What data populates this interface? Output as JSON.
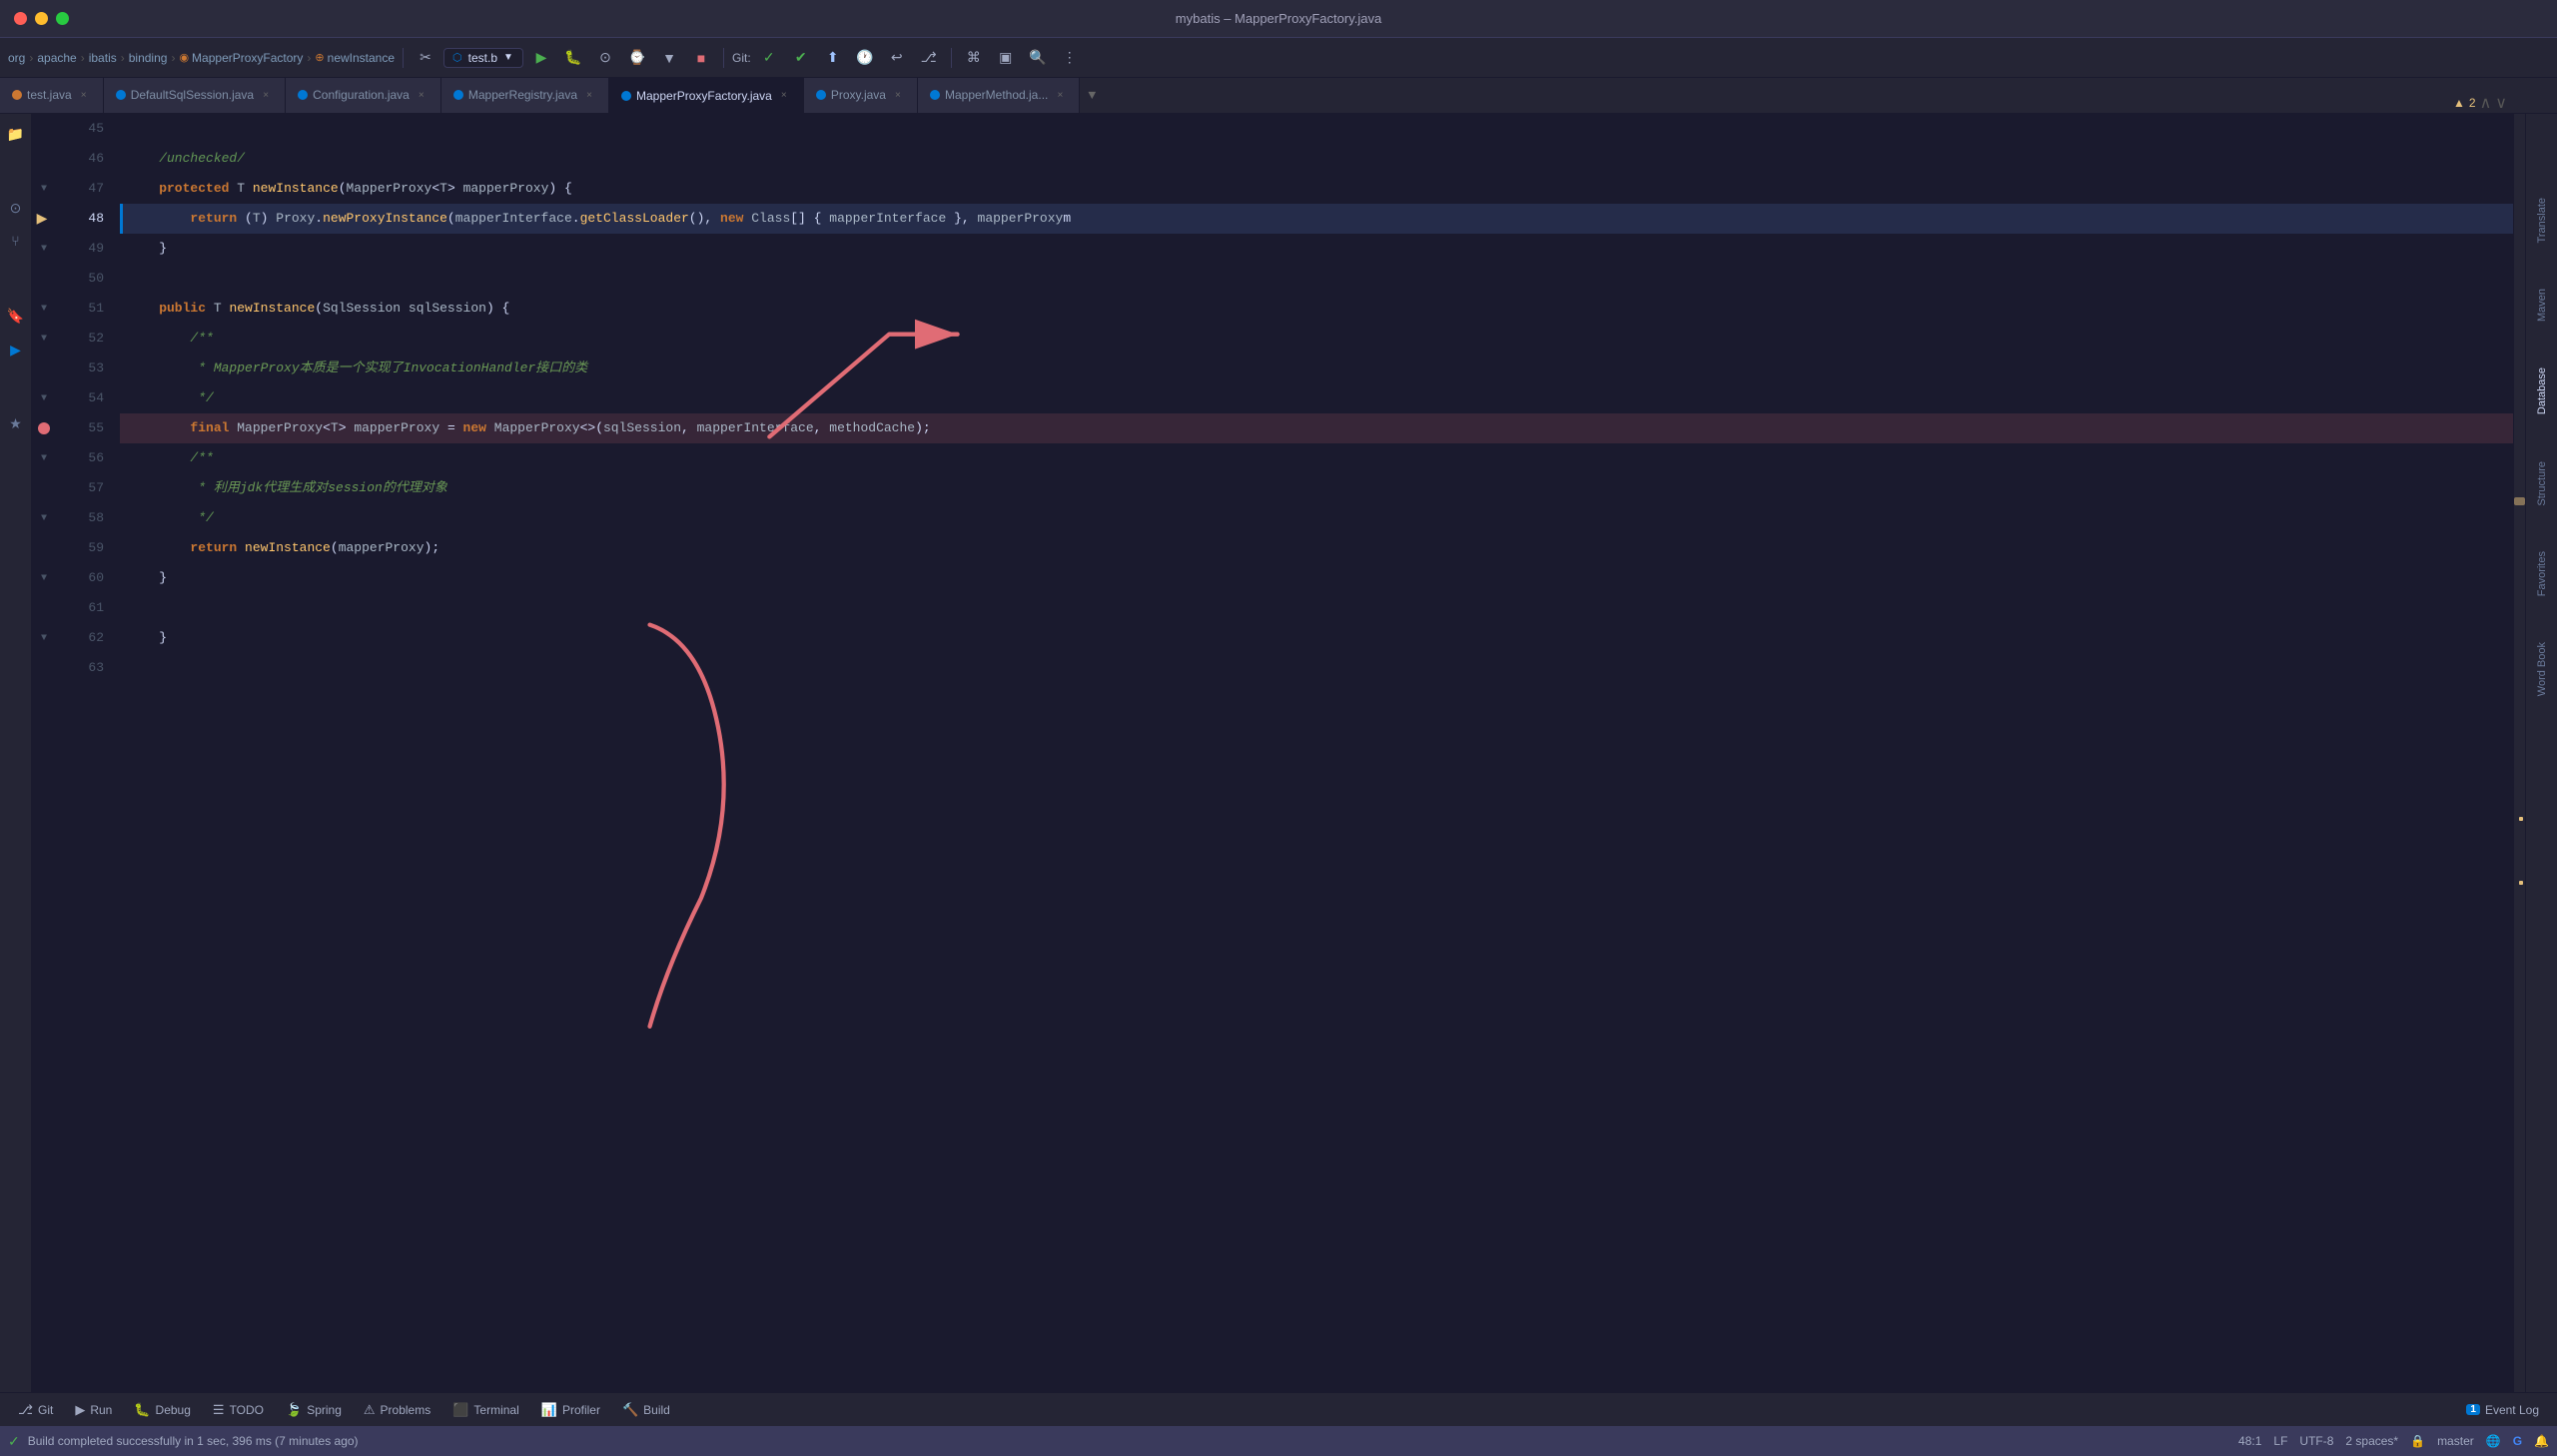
{
  "window": {
    "title": "mybatis – MapperProxyFactory.java"
  },
  "titlebar": {
    "title": "mybatis – MapperProxyFactory.java"
  },
  "toolbar": {
    "breadcrumb": [
      "org",
      "apache",
      "ibatis",
      "binding",
      "MapperProxyFactory",
      "newInstance"
    ],
    "run_config": "test.b",
    "git_label": "Git:"
  },
  "tabs": [
    {
      "label": "test.java",
      "color": "java",
      "active": false,
      "closeable": true
    },
    {
      "label": "DefaultSqlSession.java",
      "color": "java-blue",
      "active": false,
      "closeable": true
    },
    {
      "label": "Configuration.java",
      "color": "java-blue",
      "active": false,
      "closeable": true
    },
    {
      "label": "MapperRegistry.java",
      "color": "java-blue",
      "active": false,
      "closeable": true
    },
    {
      "label": "MapperProxyFactory.java",
      "color": "java-blue",
      "active": true,
      "closeable": true
    },
    {
      "label": "Proxy.java",
      "color": "java-blue",
      "active": false,
      "closeable": true
    },
    {
      "label": "MapperMethod.ja...",
      "color": "java-blue",
      "active": false,
      "closeable": true
    }
  ],
  "warning": {
    "count": "2",
    "symbol": "▲"
  },
  "code": {
    "lines": [
      {
        "num": 45,
        "content": "",
        "type": "empty"
      },
      {
        "num": 46,
        "content": "    /unchecked/",
        "type": "comment"
      },
      {
        "num": 47,
        "content": "    protected T newInstance(MapperProxy<T> mapperProxy) {",
        "type": "code"
      },
      {
        "num": 48,
        "content": "        return (T) Proxy.newProxyInstance(mapperInterface.getClassLoader(), new Class[] { mapperInterface }, mapperProxy",
        "type": "code",
        "active": true
      },
      {
        "num": 49,
        "content": "    }",
        "type": "code"
      },
      {
        "num": 50,
        "content": "",
        "type": "empty"
      },
      {
        "num": 51,
        "content": "    public T newInstance(SqlSession sqlSession) {",
        "type": "code"
      },
      {
        "num": 52,
        "content": "        /**",
        "type": "comment"
      },
      {
        "num": 53,
        "content": "         * MapperProxy本质是一个实现了InvocationHandler接口的类",
        "type": "comment-chinese"
      },
      {
        "num": 54,
        "content": "         */",
        "type": "comment"
      },
      {
        "num": 55,
        "content": "        final MapperProxy<T> mapperProxy = new MapperProxy<>(sqlSession, mapperInterface, methodCache);",
        "type": "code",
        "breakpoint": true
      },
      {
        "num": 56,
        "content": "        /**",
        "type": "comment"
      },
      {
        "num": 57,
        "content": "         * 利用jdk代理生成对session的代理对象",
        "type": "comment-chinese"
      },
      {
        "num": 58,
        "content": "         */",
        "type": "comment"
      },
      {
        "num": 59,
        "content": "        return newInstance(mapperProxy);",
        "type": "code"
      },
      {
        "num": 60,
        "content": "    }",
        "type": "code"
      },
      {
        "num": 61,
        "content": "",
        "type": "empty"
      },
      {
        "num": 62,
        "content": "}",
        "type": "code"
      },
      {
        "num": 63,
        "content": "",
        "type": "empty"
      }
    ]
  },
  "sidebar_right": {
    "labels": [
      "Translate",
      "Maven",
      "Database",
      "Structure",
      "Favorites",
      "Word Book"
    ]
  },
  "sidebar_left": {
    "icons": [
      "project",
      "commit",
      "pull-requests",
      "bookmarks",
      "run-debug"
    ]
  },
  "statusbar": {
    "build_status": "Build completed successfully in 1 sec, 396 ms (7 minutes ago)",
    "position": "48:1",
    "line_sep": "LF",
    "encoding": "UTF-8",
    "indent": "2 spaces*",
    "vcs": "master"
  },
  "bottom_toolbar": {
    "buttons": [
      "Git",
      "Run",
      "Debug",
      "TODO",
      "Spring",
      "Problems",
      "Terminal",
      "Profiler",
      "Build"
    ],
    "icons": [
      "git",
      "run",
      "debug",
      "todo",
      "spring",
      "problems",
      "terminal",
      "profiler",
      "build"
    ],
    "event_log": "Event Log",
    "event_log_badge": "1"
  }
}
